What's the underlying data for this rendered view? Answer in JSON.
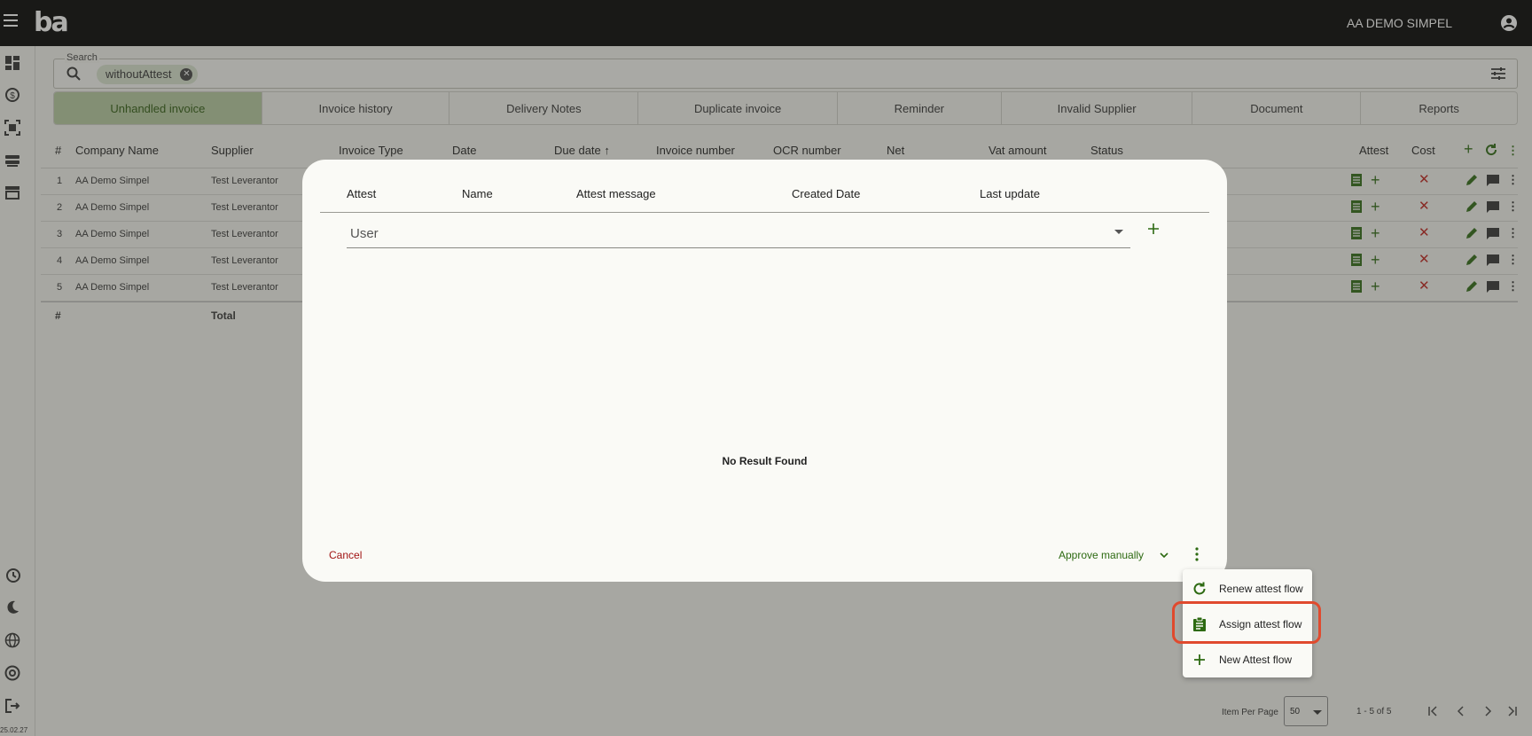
{
  "app": {
    "logo": "ba",
    "org_name": "AA DEMO SIMPEL",
    "version": "25.02.27"
  },
  "search": {
    "label": "Search",
    "chip": "withoutAttest"
  },
  "tabs": [
    {
      "label": "Unhandled invoice",
      "active": true
    },
    {
      "label": "Invoice history"
    },
    {
      "label": "Delivery Notes"
    },
    {
      "label": "Duplicate invoice"
    },
    {
      "label": "Reminder"
    },
    {
      "label": "Invalid Supplier"
    },
    {
      "label": "Document"
    },
    {
      "label": "Reports"
    }
  ],
  "table": {
    "headers": {
      "num": "#",
      "company": "Company Name",
      "supplier": "Supplier",
      "type": "Invoice Type",
      "date": "Date",
      "due": "Due date",
      "invoice_no": "Invoice number",
      "ocr": "OCR number",
      "net": "Net",
      "vat": "Vat amount",
      "status": "Status",
      "attest": "Attest",
      "cost": "Cost"
    },
    "rows": [
      {
        "num": "1",
        "company": "AA Demo Simpel",
        "supplier": "Test Leverantor"
      },
      {
        "num": "2",
        "company": "AA Demo Simpel",
        "supplier": "Test Leverantor"
      },
      {
        "num": "3",
        "company": "AA Demo Simpel",
        "supplier": "Test Leverantor"
      },
      {
        "num": "4",
        "company": "AA Demo Simpel",
        "supplier": "Test Leverantor"
      },
      {
        "num": "5",
        "company": "AA Demo Simpel",
        "supplier": "Test Leverantor"
      }
    ],
    "footer": {
      "num": "#",
      "total": "Total"
    }
  },
  "dialog": {
    "headers": {
      "attest": "Attest",
      "name": "Name",
      "message": "Attest message",
      "created": "Created Date",
      "updated": "Last update"
    },
    "user_select": "User",
    "empty": "No Result Found",
    "cancel": "Cancel",
    "approve": "Approve manually"
  },
  "context_menu": [
    {
      "label": "Renew attest flow",
      "icon": "refresh-icon"
    },
    {
      "label": "Assign attest flow",
      "icon": "assignment-icon",
      "highlighted": true
    },
    {
      "label": "New Attest flow",
      "icon": "plus-icon"
    }
  ],
  "pagination": {
    "label": "Item Per Page",
    "per_page": "50",
    "range": "1 - 5 of 5"
  },
  "colors": {
    "accent_green": "#2d6a12",
    "active_tab": "#b7cba0",
    "cancel_red": "#a11414",
    "highlight": "#e04a2e"
  }
}
